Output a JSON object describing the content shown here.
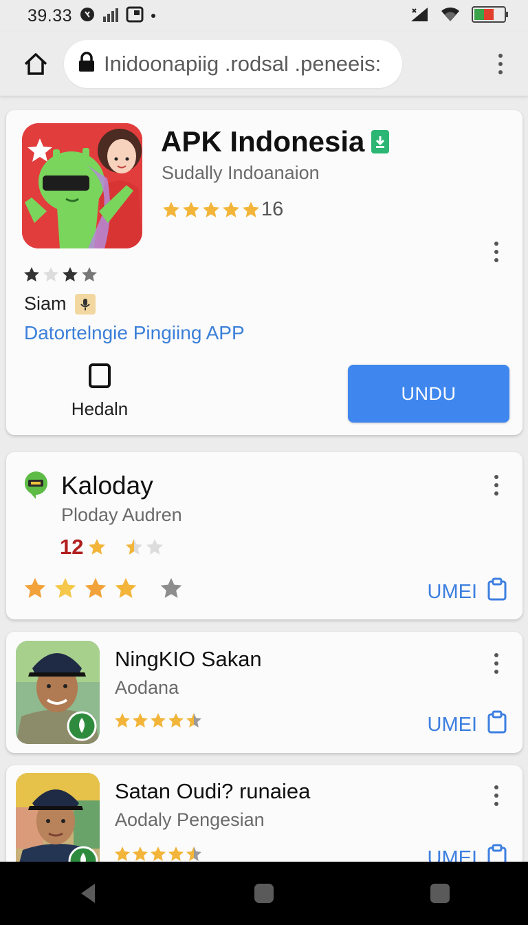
{
  "status_bar": {
    "time": "39.33",
    "icons": [
      "alarm-icon",
      "signal-bars-icon",
      "cast-icon",
      "notification-dot-icon",
      "cellular-signal-icon",
      "wifi-icon",
      "battery-icon"
    ]
  },
  "browser": {
    "url": "Inidoonapiig .rodsal .peneeis:",
    "icons": [
      "home-icon",
      "lock-icon",
      "overflow-menu-icon"
    ]
  },
  "featured_app": {
    "title": "APK Indonesia",
    "subtitle": "Sudally Indoanaion",
    "rating_count": "16",
    "rating_stars": 5,
    "small_rating_stars": 3,
    "publisher": "Siam",
    "link": "Datortelngie Pingiing APP",
    "secondary_action_label": "Hedaln",
    "install_label": "UNDU",
    "accent_color": "#3f87ee",
    "icon_bg_color": "#e23d3d"
  },
  "apps": [
    {
      "title": "Kaloday",
      "subtitle": "Ploday Audren",
      "rating_number": "12",
      "action_label": "UMEI",
      "rating_stars": 4
    },
    {
      "title": "NingKIO Sakan",
      "subtitle": "Aodana",
      "action_label": "UMEI",
      "rating_stars": 4
    },
    {
      "title": "Satan Oudi? runaiea",
      "subtitle": "Aodaly Pengesian",
      "action_label": "UMEI",
      "rating_stars": 4
    }
  ],
  "colors": {
    "star_gold": "#f2b53a",
    "star_gray": "#9a9a9a",
    "link_blue": "#3b7fd9",
    "rating_red": "#b21f1f"
  },
  "nav": {
    "icons": [
      "back-icon",
      "home-nav-icon",
      "recents-icon"
    ]
  }
}
